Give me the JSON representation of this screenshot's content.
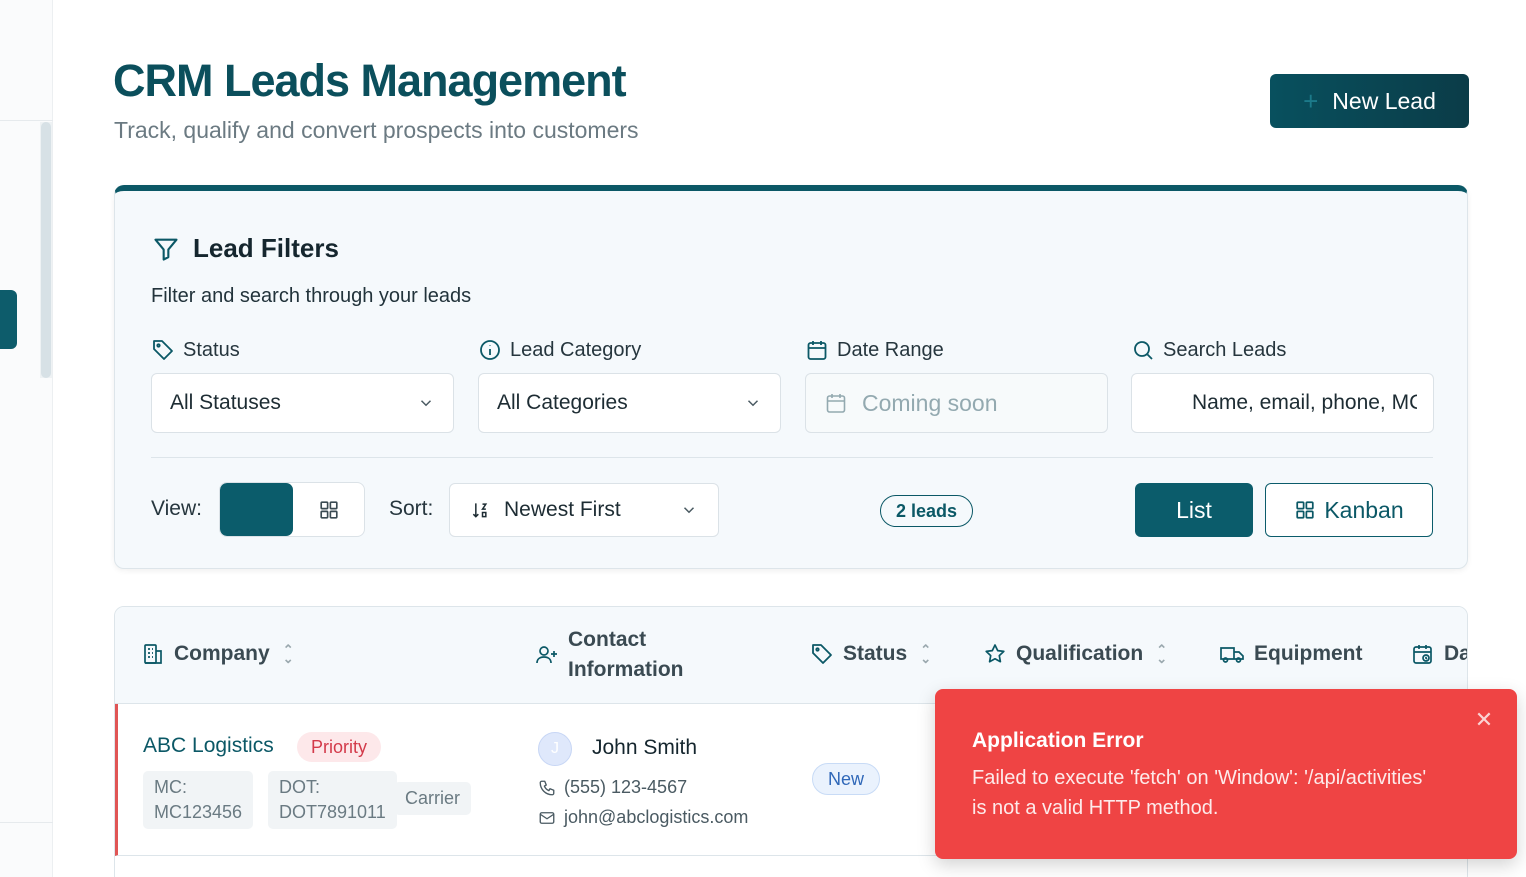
{
  "header": {
    "title": "CRM Leads Management",
    "subtitle": "Track, qualify and convert prospects into customers",
    "new_lead_label": "New Lead"
  },
  "filters": {
    "title": "Lead Filters",
    "subtitle": "Filter and search through your leads",
    "status": {
      "label": "Status",
      "value": "All Statuses"
    },
    "category": {
      "label": "Lead Category",
      "value": "All Categories"
    },
    "date_range": {
      "label": "Date Range",
      "value": "Coming soon"
    },
    "search": {
      "label": "Search Leads",
      "placeholder": "Name, email, phone, MC"
    },
    "view_label": "View:",
    "sort_label": "Sort:",
    "sort_value": "Newest First",
    "lead_count": "2 leads",
    "list_label": "List",
    "kanban_label": "Kanban"
  },
  "table": {
    "columns": {
      "company": "Company",
      "contact_line1": "Contact",
      "contact_line2": "Information",
      "status": "Status",
      "qualification": "Qualification",
      "equipment": "Equipment",
      "date": "Da"
    },
    "rows": [
      {
        "company": "ABC Logistics",
        "priority": "Priority",
        "mc_label": "MC:",
        "mc_value": "MC123456",
        "dot_label": "DOT:",
        "dot_value": "DOT7891011",
        "type": "Carrier",
        "avatar_initial": "J",
        "contact_name": "John Smith",
        "phone": "(555) 123-4567",
        "email": "john@abclogistics.com",
        "status": "New"
      }
    ]
  },
  "toast": {
    "title": "Application Error",
    "message": "Failed to execute 'fetch' on 'Window': '/api/activities' is not a valid HTTP method.",
    "close_icon": "close-icon"
  },
  "colors": {
    "brand": "#0b5866",
    "error": "#ef4444",
    "priority": "#d33a4a"
  }
}
